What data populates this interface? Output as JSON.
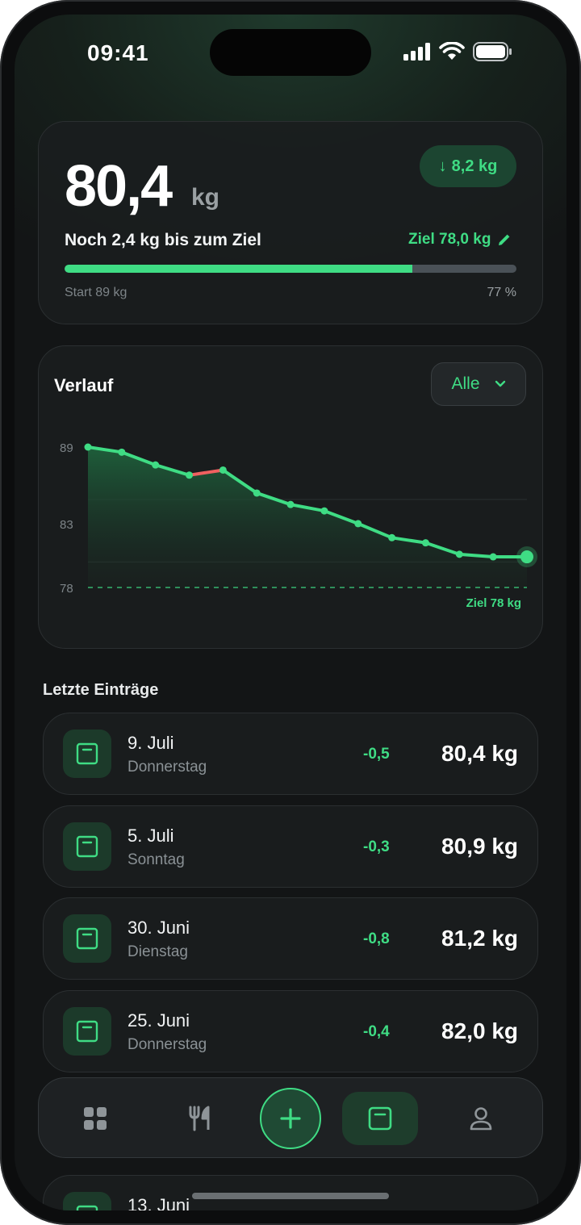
{
  "status_bar": {
    "time": "09:41"
  },
  "summary": {
    "current_weight": "80,4",
    "unit": "kg",
    "change_badge": "8,2 kg",
    "remaining_text": "Noch 2,4 kg bis zum Ziel",
    "goal_link": "Ziel 78,0 kg",
    "start_label": "Start 89 kg",
    "progress_label": "77 %",
    "progress_fraction": 0.77
  },
  "chart_section": {
    "title": "Verlauf",
    "filter_label": "Alle"
  },
  "chart_data": {
    "type": "area",
    "y_ticks": [
      "89",
      "83",
      "78"
    ],
    "ylim": [
      78,
      89
    ],
    "goal_line_label": "Ziel 78 kg",
    "goal_value": 78,
    "series": [
      {
        "values": [
          89.0,
          88.6,
          87.6,
          86.8,
          87.2,
          85.4,
          84.5,
          84.0,
          83.0,
          81.9,
          81.5,
          80.6,
          80.4,
          80.4
        ]
      }
    ],
    "highlight_segment": [
      3,
      4
    ],
    "line_color": "#3fdc84",
    "increase_color": "#f06060"
  },
  "recent": {
    "title": "Letzte Einträge",
    "entries": [
      {
        "date": "9. Juli",
        "weekday": "Donnerstag",
        "diff": "-0,5",
        "value": "80,4 kg"
      },
      {
        "date": "5. Juli",
        "weekday": "Sonntag",
        "diff": "-0,3",
        "value": "80,9 kg"
      },
      {
        "date": "30. Juni",
        "weekday": "Dienstag",
        "diff": "-0,8",
        "value": "81,2 kg"
      },
      {
        "date": "25. Juni",
        "weekday": "Donnerstag",
        "diff": "-0,4",
        "value": "82,0 kg"
      },
      {
        "date": "13. Juni",
        "weekday": "",
        "diff": "",
        "value": ""
      }
    ]
  },
  "tabbar": {
    "tabs": [
      "grid-icon",
      "fork-knife-icon",
      "plus-icon",
      "scale-icon",
      "person-icon"
    ],
    "active": "scale-icon"
  },
  "colors": {
    "accent": "#3fdc84",
    "background": "#131516",
    "card": "#1a1d1e"
  }
}
